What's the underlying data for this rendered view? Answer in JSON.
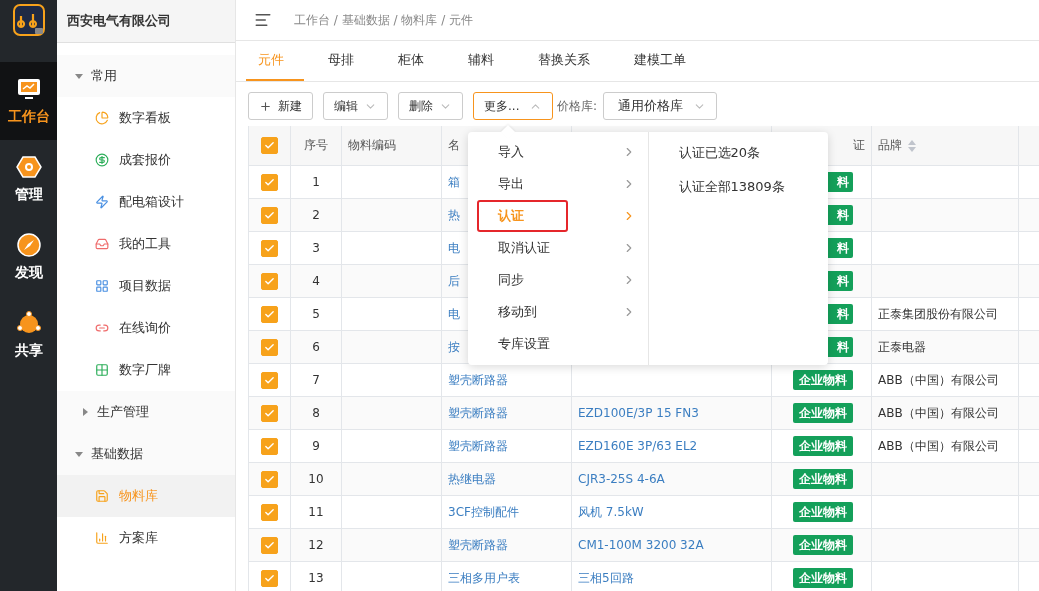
{
  "rail": {
    "items": [
      {
        "label": "工作台",
        "selected": true
      },
      {
        "label": "管理",
        "selected": false
      },
      {
        "label": "发现",
        "selected": false
      },
      {
        "label": "共享",
        "selected": false
      }
    ]
  },
  "sidebar": {
    "company": "西安电气有限公司",
    "groups": [
      {
        "label": "常用",
        "expanded": true,
        "children": [
          {
            "label": "数字看板",
            "selected": false
          },
          {
            "label": "成套报价",
            "selected": false
          },
          {
            "label": "配电箱设计",
            "selected": false
          },
          {
            "label": "我的工具",
            "selected": false
          },
          {
            "label": "项目数据",
            "selected": false
          },
          {
            "label": "在线询价",
            "selected": false
          },
          {
            "label": "数字厂牌",
            "selected": false
          }
        ]
      },
      {
        "label": "生产管理",
        "expanded": false
      },
      {
        "label": "基础数据",
        "expanded": true,
        "children": [
          {
            "label": "物料库",
            "selected": true
          },
          {
            "label": "方案库",
            "selected": false
          }
        ]
      }
    ]
  },
  "breadcrumb": "工作台 / 基础数据 / 物料库 / 元件",
  "tabs": [
    {
      "label": "元件",
      "selected": true
    },
    {
      "label": "母排",
      "selected": false
    },
    {
      "label": "柜体",
      "selected": false
    },
    {
      "label": "辅料",
      "selected": false
    },
    {
      "label": "替换关系",
      "selected": false
    },
    {
      "label": "建模工单",
      "selected": false
    }
  ],
  "toolbar": {
    "buttons": [
      {
        "label": "新建",
        "kind": "add"
      },
      {
        "label": "编辑",
        "kind": "dropdown"
      },
      {
        "label": "删除",
        "kind": "dropdown"
      }
    ],
    "more": {
      "label": "更多...",
      "open": true
    },
    "price_library": {
      "label": "价格库:",
      "value": "通用价格库"
    }
  },
  "table": {
    "all_checked": true,
    "columns": [
      "序号",
      "物料编码",
      "名",
      "证",
      "品牌"
    ],
    "rows": [
      {
        "checked": true,
        "index": "1",
        "name": "箱",
        "badge": "料"
      },
      {
        "checked": true,
        "index": "2",
        "name": "热",
        "badge": "料"
      },
      {
        "checked": true,
        "index": "3",
        "name": "电",
        "badge": "料"
      },
      {
        "checked": true,
        "index": "4",
        "name": "后",
        "badge": "料"
      },
      {
        "checked": true,
        "index": "5",
        "name": "电",
        "badge": "料",
        "brand": "正泰集团股份有限公司"
      },
      {
        "checked": true,
        "index": "6",
        "name": "按",
        "badge": "料",
        "brand": "正泰电器"
      },
      {
        "checked": true,
        "index": "7",
        "name": "塑壳断路器",
        "badge": "企业物料",
        "brand": "ABB（中国）有限公司"
      },
      {
        "checked": true,
        "index": "8",
        "name": "塑壳断路器",
        "model": "EZD100E/3P 15 FN3",
        "badge": "企业物料",
        "brand": "ABB（中国）有限公司"
      },
      {
        "checked": true,
        "index": "9",
        "name": "塑壳断路器",
        "model": "EZD160E 3P/63 EL2",
        "badge": "企业物料",
        "brand": "ABB（中国）有限公司"
      },
      {
        "checked": true,
        "index": "10",
        "name": "热继电器",
        "model": "CJR3-25S 4-6A",
        "badge": "企业物料"
      },
      {
        "checked": true,
        "index": "11",
        "name": "3CF控制配件",
        "model": "风机 7.5kW",
        "badge": "企业物料"
      },
      {
        "checked": true,
        "index": "12",
        "name": "塑壳断路器",
        "model": "CM1-100M 3200 32A",
        "badge": "企业物料"
      },
      {
        "checked": true,
        "index": "13",
        "name": "三相多用户表",
        "model": "三相5回路",
        "badge": "企业物料"
      }
    ]
  },
  "menu": {
    "items": [
      {
        "label": "导入",
        "submenu": true,
        "selected": false
      },
      {
        "label": "导出",
        "submenu": true,
        "selected": false
      },
      {
        "label": "认证",
        "submenu": true,
        "selected": true
      },
      {
        "label": "取消认证",
        "submenu": true,
        "selected": false
      },
      {
        "label": "同步",
        "submenu": true,
        "selected": false
      },
      {
        "label": "移动到",
        "submenu": true,
        "selected": false
      },
      {
        "label": "专库设置",
        "submenu": false,
        "selected": false
      }
    ],
    "submenu": [
      "认证已选20条",
      "认证全部13809条"
    ]
  }
}
